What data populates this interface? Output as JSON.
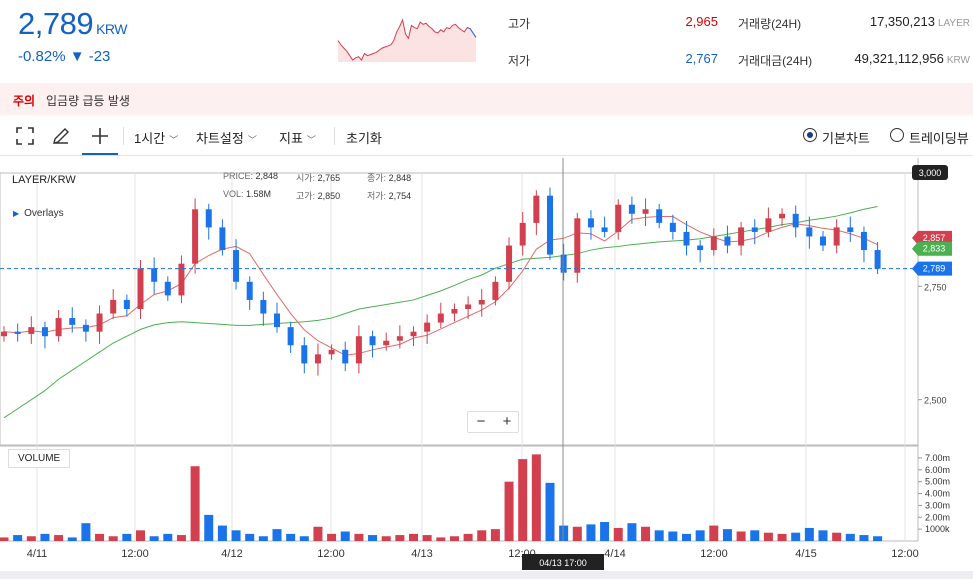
{
  "header": {
    "price": "2,789",
    "currency": "KRW",
    "change_pct": "-0.82%",
    "change_abs": "▼ -23",
    "high_label": "고가",
    "high_value": "2,965",
    "low_label": "저가",
    "low_value": "2,767",
    "volume_label": "거래량(24H)",
    "volume_value": "17,350,213",
    "volume_unit": "LAYER",
    "turnover_label": "거래대금(24H)",
    "turnover_value": "49,321,112,956",
    "turnover_unit": "KRW"
  },
  "caution": {
    "tag": "주의",
    "message": "입금량 급등 발생"
  },
  "toolbar": {
    "interval": "1시간",
    "chart_settings": "차트설정",
    "indicators": "지표",
    "reset": "초기화",
    "basic_chart": "기본차트",
    "tradingview": "트레이딩뷰",
    "icons": [
      "fullscreen-icon",
      "pencil-icon",
      "crosshair-icon"
    ]
  },
  "chart": {
    "pair": "LAYER/KRW",
    "overlays": "Overlays",
    "ohlc": {
      "price_k": "PRICE:",
      "price_v": "2,848",
      "open_k": "시가:",
      "open_v": "2,765",
      "close_k": "종가:",
      "close_v": "2,848",
      "vol_k": "VOL:",
      "vol_v": "1.58M",
      "high_k": "고가:",
      "high_v": "2,850",
      "low_k": "저가:",
      "low_v": "2,754"
    },
    "zoom_minus": "−",
    "zoom_plus": "+",
    "volume_label": "VOLUME",
    "crosshair_time": "04/13 17:00"
  },
  "chart_data": {
    "type": "line",
    "title": "",
    "xlabel": "",
    "ylabel": "",
    "x_tick_labels": [
      "4/11",
      "12:00",
      "4/12",
      "12:00",
      "4/13",
      "12:00",
      "4/14",
      "12:00",
      "4/15",
      "12:00"
    ],
    "y_tick_labels": [
      "3,000",
      "2,750",
      "2,500"
    ],
    "price_tags": [
      "2,857",
      "2,833",
      "2,789"
    ],
    "ylim": [
      2400,
      3000
    ],
    "series": [
      {
        "name": "",
        "values": [
          2650,
          2645,
          2660,
          2640,
          2680,
          2665,
          2650,
          2690,
          2720,
          2700,
          2790,
          2760,
          2730,
          2800,
          2920,
          2880,
          2830,
          2760,
          2720,
          2690,
          2660,
          2620,
          2580,
          2600,
          2610,
          2580,
          2640,
          2620,
          2630,
          2640,
          2650,
          2670,
          2690,
          2700,
          2710,
          2720,
          2760,
          2840,
          2890,
          2950,
          2820,
          2780,
          2900,
          2880,
          2870,
          2930,
          2910,
          2920,
          2890,
          2870,
          2840,
          2830,
          2860,
          2840,
          2880,
          2870,
          2900,
          2910,
          2880,
          2860,
          2840,
          2880,
          2870,
          2830,
          2789
        ]
      },
      {
        "name": "",
        "values": [
          2460,
          2480,
          2500,
          2520,
          2545,
          2565,
          2585,
          2605,
          2625,
          2640,
          2655,
          2665,
          2670,
          2672,
          2670,
          2668,
          2666,
          2664,
          2664,
          2666,
          2668,
          2670,
          2672,
          2675,
          2680,
          2690,
          2700,
          2705,
          2710,
          2715,
          2720,
          2730,
          2740,
          2752,
          2765,
          2775,
          2790,
          2800,
          2810,
          2812,
          2814,
          2818,
          2822,
          2830,
          2835,
          2838,
          2842,
          2845,
          2848,
          2850,
          2852,
          2855,
          2860,
          2865,
          2870,
          2875,
          2880,
          2886,
          2890,
          2896,
          2900,
          2905,
          2912,
          2920,
          2926
        ]
      }
    ],
    "volume_axis_labels": [
      "7.00m",
      "6.00m",
      "5.00m",
      "4.00m",
      "3.00m",
      "2.00m",
      "1000k"
    ],
    "volume_values": [
      0.3,
      0.5,
      0.4,
      0.6,
      0.5,
      0.3,
      1.5,
      0.6,
      0.4,
      0.6,
      0.9,
      0.4,
      0.6,
      0.5,
      6.3,
      2.2,
      1.3,
      0.9,
      0.6,
      0.4,
      1.0,
      0.6,
      0.4,
      1.2,
      0.6,
      0.8,
      0.6,
      0.5,
      0.4,
      0.5,
      0.6,
      0.5,
      0.3,
      0.4,
      0.6,
      0.9,
      1.0,
      5.0,
      6.9,
      7.3,
      4.9,
      1.3,
      1.2,
      1.4,
      1.6,
      1.1,
      1.5,
      1.2,
      0.9,
      0.8,
      0.6,
      0.9,
      1.3,
      1.0,
      0.8,
      0.9,
      0.7,
      0.6,
      0.7,
      1.1,
      0.9,
      0.7,
      0.6,
      0.5,
      0.4
    ],
    "colors": {
      "up": "#d23f4f",
      "down": "#1a73e8",
      "ma_short": "#e36a6a",
      "ma_long": "#4caf50",
      "accent": "#1261c4",
      "alert": "#d60000"
    }
  }
}
